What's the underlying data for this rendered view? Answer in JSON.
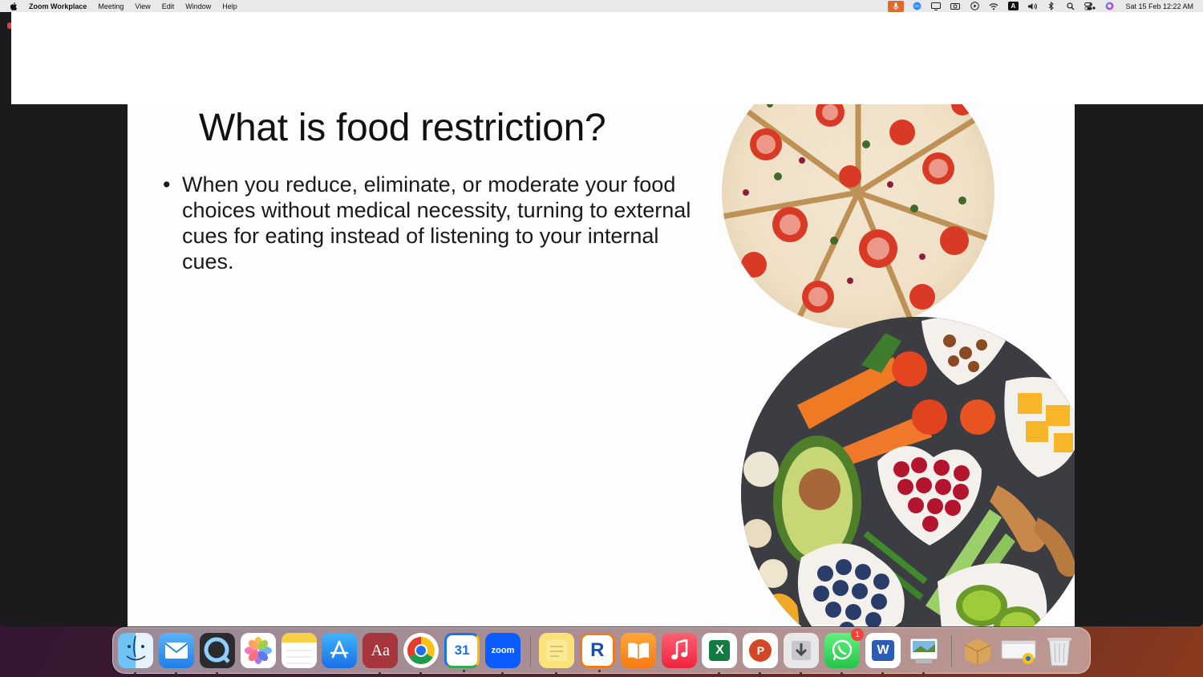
{
  "menubar": {
    "app_name": "Zoom Workplace",
    "menus": [
      "Meeting",
      "View",
      "Edit",
      "Window",
      "Help"
    ],
    "status_icons": [
      "mic-active-icon",
      "zoom-status-icon",
      "display-icon",
      "camera-icon",
      "play-icon",
      "wifi-icon",
      "input-source-icon",
      "volume-icon",
      "bluetooth-icon",
      "spotlight-icon",
      "control-center-icon",
      "siri-icon"
    ],
    "input_source_label": "A",
    "clock": "Sat 15 Feb  12:22 AM"
  },
  "slide": {
    "title": "What is food restriction?",
    "bullets": [
      "When you reduce, eliminate, or moderate your food choices without medical necessity, turning to external cues for eating instead of listening to your internal cues."
    ]
  },
  "dock": {
    "apps": [
      {
        "name": "Finder",
        "icon": "finder-icon"
      },
      {
        "name": "Mail",
        "icon": "mail-icon"
      },
      {
        "name": "QuickTime Player",
        "icon": "quicktime-icon"
      },
      {
        "name": "Photos",
        "icon": "photos-icon"
      },
      {
        "name": "Notes",
        "icon": "notes-icon"
      },
      {
        "name": "App Store",
        "icon": "app-store-icon"
      },
      {
        "name": "Dictionary",
        "icon": "dictionary-icon",
        "label": "Aa"
      },
      {
        "name": "Google Chrome",
        "icon": "chrome-icon"
      },
      {
        "name": "Google Calendar",
        "icon": "calendar-icon",
        "label": "31"
      },
      {
        "name": "Zoom",
        "icon": "zoom-icon",
        "label": "zoom"
      },
      {
        "name": "Stickies",
        "icon": "stickies-icon"
      },
      {
        "name": "RoboForm",
        "icon": "roboform-icon",
        "label": "R"
      },
      {
        "name": "Books",
        "icon": "books-icon"
      },
      {
        "name": "Music",
        "icon": "music-icon"
      },
      {
        "name": "Excel",
        "icon": "excel-icon",
        "label": "X"
      },
      {
        "name": "PowerPoint",
        "icon": "powerpoint-icon",
        "label": "P"
      },
      {
        "name": "Installer",
        "icon": "installer-icon"
      },
      {
        "name": "WhatsApp",
        "icon": "whatsapp-icon",
        "badge": "1"
      },
      {
        "name": "Word",
        "icon": "word-icon",
        "label": "W"
      },
      {
        "name": "Preview",
        "icon": "preview-icon"
      },
      {
        "name": "Archive Utility",
        "icon": "archive-icon"
      },
      {
        "name": "Chrome Window",
        "icon": "chrome-window-icon"
      },
      {
        "name": "Trash",
        "icon": "trash-icon"
      }
    ]
  }
}
